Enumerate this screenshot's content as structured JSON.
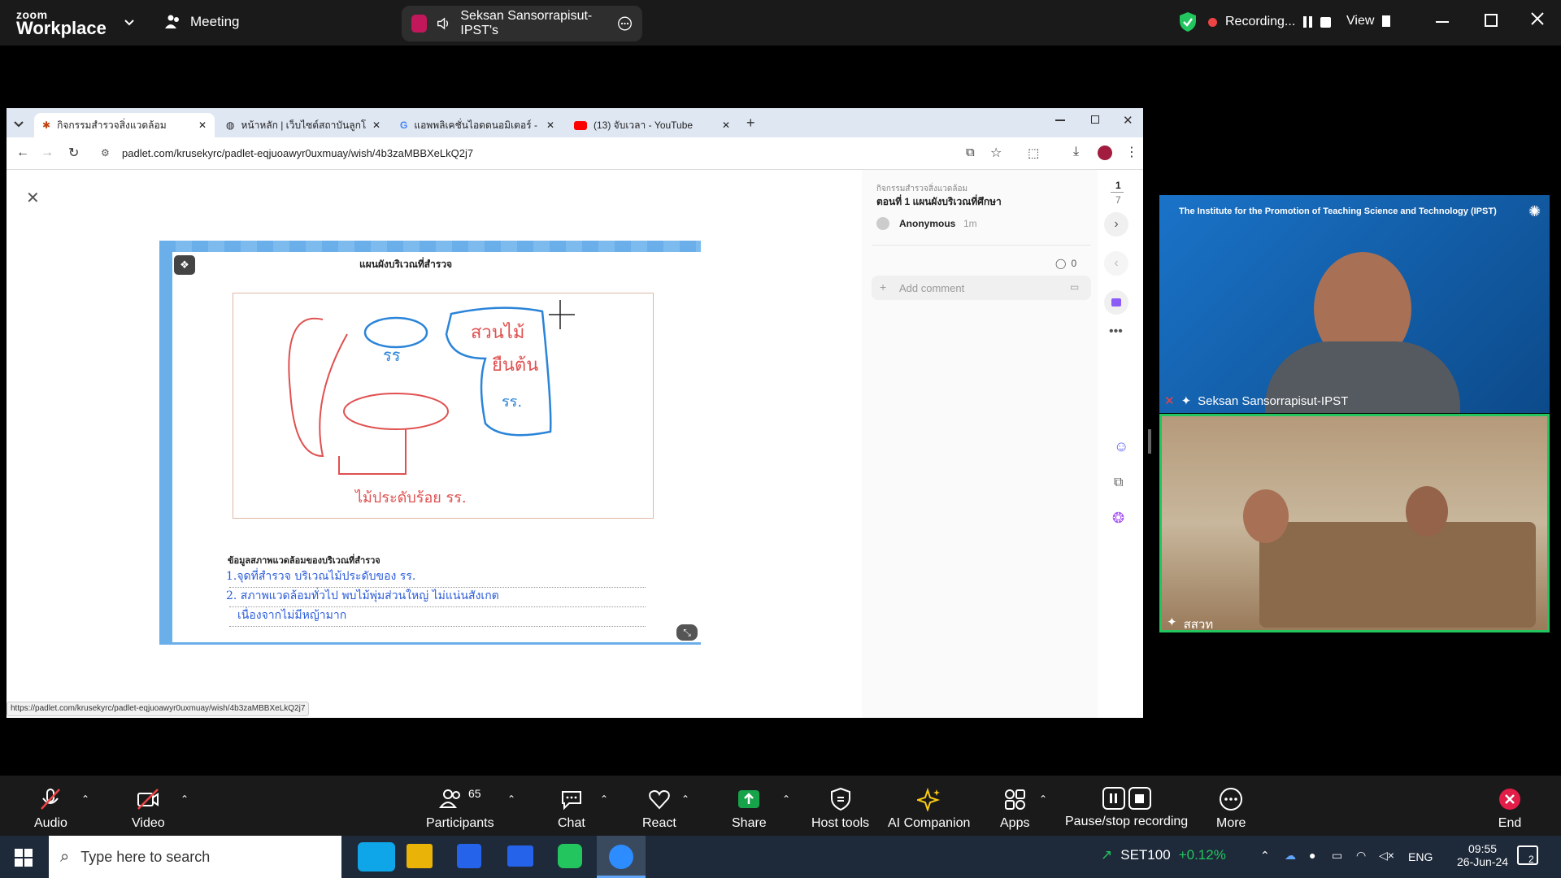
{
  "zoom": {
    "brand_top": "zoom",
    "brand_bottom": "Workplace",
    "meeting_label": "Meeting",
    "speaker_pill": "Seksan Sansorrapisut-IPST's",
    "recording_label": "Recording...",
    "view_label": "View"
  },
  "browser": {
    "tabs": [
      {
        "label": "กิจกรรมสำรวจสิ่งแวดล้อม",
        "active": true
      },
      {
        "label": "หน้าหลัก | เว็บไซต์สถาบันลูกโลกสีเขี..."
      },
      {
        "label": "แอพพลิเคชั่นไอดดนอมิเตอร์ - ค้นหาด้..."
      },
      {
        "label": "(13) จับเวลา - YouTube"
      }
    ],
    "url": "padlet.com/krusekyrc/padlet-eqjuoawyr0uxmuay/wish/4b3zaMBBXeLkQ2j7",
    "status_url": "https://padlet.com/krusekyrc/padlet-eqjuoawyr0uxmuay/wish/4b3zaMBBXeLkQ2j7"
  },
  "padlet": {
    "section_label": "กิจกรรมสำรวจสิ่งแวดล้อม",
    "post_title": "ตอนที่ 1 แผนผังบริเวณที่ศึกษา",
    "author": "Anonymous",
    "time": "1m",
    "page_current": "1",
    "page_total": "7",
    "comment_count": "0",
    "add_comment": "Add comment",
    "slide_title": "แผนผังบริเวณที่สำรวจ",
    "slide_section": "ข้อมูลสภาพแวดล้อมของบริเวณที่สำรวจ",
    "sketch_label_1": "สวนไม้",
    "sketch_label_2": "ยืนต้น",
    "sketch_label_3": "รร",
    "sketch_label_4": "รร.",
    "sketch_bottom": "ไม้ประดับร้อย รร.",
    "note_line_1": "1.จุดที่สำรวจ บริเวณไม้ประดับของ รร.",
    "note_line_2": "2. สภาพแวดล้อมทั่วไป พบไม้พุ่มส่วนใหญ่ ไม่แน่นสังเกต",
    "note_line_3": "เนื่องจากไม่มีหญ้ามาก"
  },
  "participants": {
    "top_name": "Seksan Sansorrapisut-IPST",
    "top_banner": "The Institute for the Promotion of Teaching Science and Technology (IPST)",
    "bottom_name": "สสวท"
  },
  "toolbar": {
    "audio": "Audio",
    "video": "Video",
    "participants": "Participants",
    "participants_count": "65",
    "chat": "Chat",
    "react": "React",
    "share": "Share",
    "host_tools": "Host tools",
    "ai_companion": "AI Companion",
    "apps": "Apps",
    "pause_stop": "Pause/stop recording",
    "more": "More",
    "end": "End"
  },
  "taskbar": {
    "search_placeholder": "Type here to search",
    "stock_name": "SET100",
    "stock_change": "+0.12%",
    "lang": "ENG",
    "time": "09:55",
    "date": "26-Jun-24",
    "notif_count": "2"
  },
  "colors": {
    "accent_green": "#22c55e",
    "recording_red": "#ef4444",
    "share_green": "#16a34a",
    "end_red": "#e11d48"
  }
}
